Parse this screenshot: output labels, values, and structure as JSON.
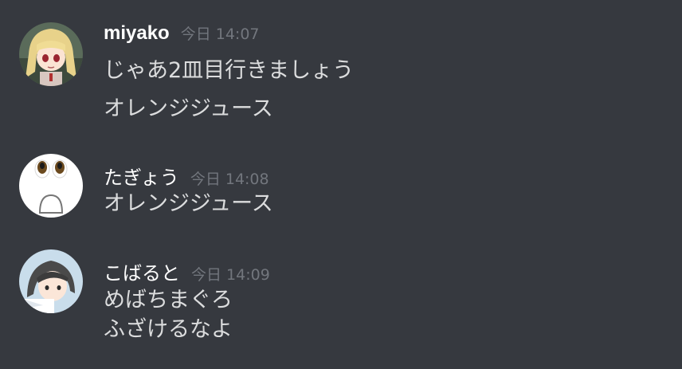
{
  "messages": [
    {
      "username": "miyako",
      "timestamp": "今日 14:07",
      "avatar": "anime-blonde-girl-avatar",
      "lines": [
        "じゃあ2皿目行きましょう",
        "オレンジジュース"
      ]
    },
    {
      "username": "たぎょう",
      "timestamp": "今日 14:08",
      "avatar": "surprised-face-avatar",
      "lines": [
        "オレンジジュース"
      ]
    },
    {
      "username": "こばると",
      "timestamp": "今日 14:09",
      "avatar": "anime-dark-hair-boy-avatar",
      "lines": [
        "めばちまぐろ",
        "ふざけるなよ"
      ]
    }
  ],
  "colors": {
    "background": "#36393f",
    "username": "#ffffff",
    "timestamp": "#72767d",
    "text": "#dcddde"
  }
}
